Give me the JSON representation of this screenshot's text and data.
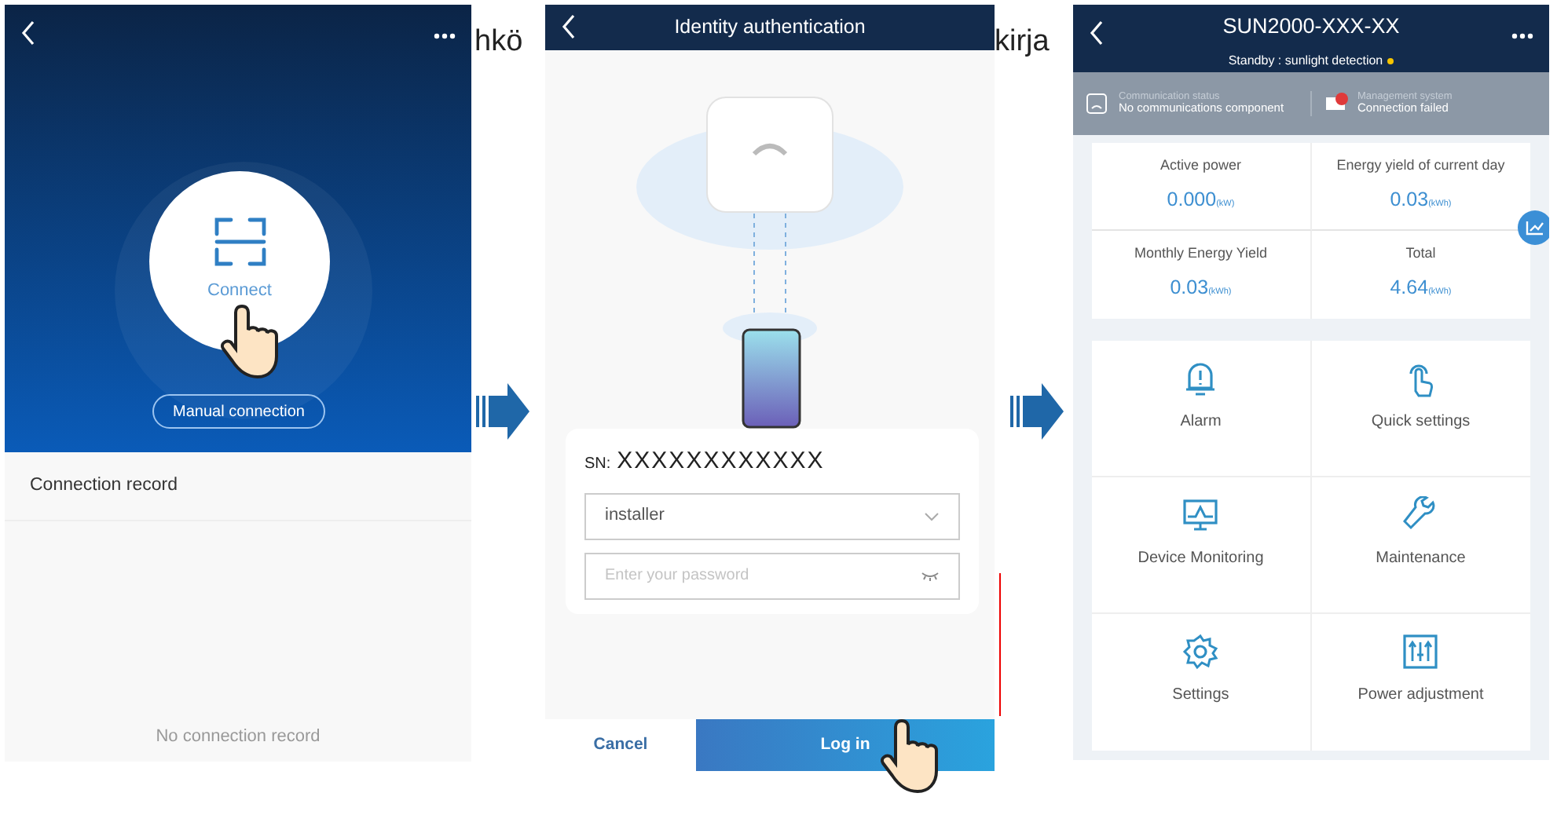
{
  "caption_fragments": [
    "hkö",
    "kirja"
  ],
  "connect_screen": {
    "connect_label": "Connect",
    "manual_button": "Manual connection",
    "record_title": "Connection record",
    "empty_text": "No connection record"
  },
  "auth_screen": {
    "title": "Identity authentication",
    "sn_label": "SN:",
    "sn_value": "XXXXXXXXXXXX",
    "user_field": {
      "value": "installer"
    },
    "password_field": {
      "placeholder": "Enter your password"
    },
    "buttons": [
      {
        "label": "Cancel",
        "kind": "text"
      },
      {
        "label": "Log in",
        "kind": "primary"
      }
    ]
  },
  "device_screen": {
    "title": "SUN2000-XXX-XX",
    "subtitle": "Standby : sunlight detection",
    "status_items": [
      {
        "kind": "comm",
        "label": "Communication status",
        "value": "No communications component"
      },
      {
        "kind": "mgmt",
        "label": "Management system",
        "value": "Connection failed"
      }
    ],
    "stats": [
      {
        "label": "Active power",
        "value": "0.000",
        "unit": "(kW)"
      },
      {
        "label": "Energy yield of current day",
        "value": "0.03",
        "unit": "(kWh)"
      },
      {
        "label": "Monthly Energy Yield",
        "value": "0.03",
        "unit": "(kWh)"
      },
      {
        "label": "Total",
        "value": "4.64",
        "unit": "(kWh)"
      }
    ],
    "menu": [
      {
        "kind": "alarm",
        "label": "Alarm"
      },
      {
        "kind": "touch",
        "label": "Quick settings"
      },
      {
        "kind": "monitor",
        "label": "Device Monitoring"
      },
      {
        "kind": "wrench",
        "label": "Maintenance"
      },
      {
        "kind": "gear",
        "label": "Settings"
      },
      {
        "kind": "sliders",
        "label": "Power adjustment"
      }
    ]
  }
}
